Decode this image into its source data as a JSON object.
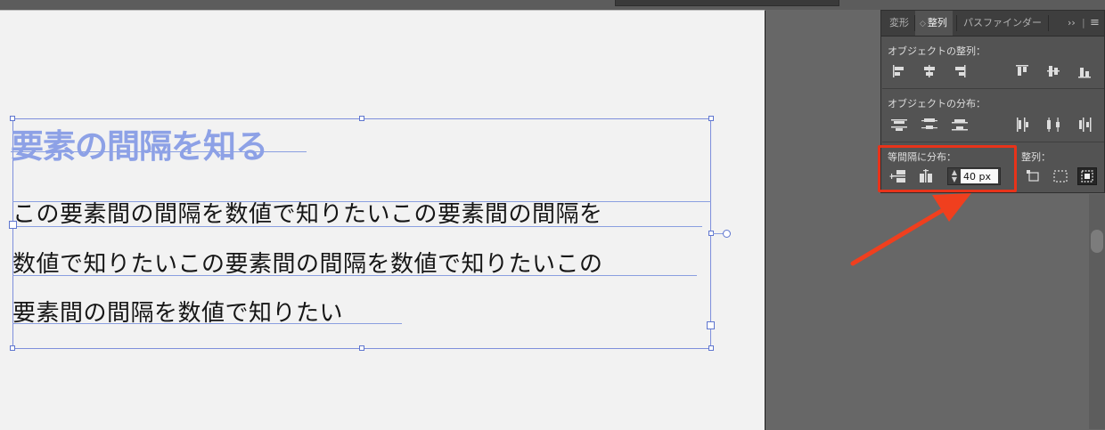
{
  "artboard": {
    "heading": "要素の間隔を知る",
    "body_lines": [
      "この要素間の間隔を数値で知りたいこの要素間の間隔を",
      "数値で知りたいこの要素間の間隔を数値で知りたいこの",
      "要素間の間隔を数値で知りたい"
    ]
  },
  "panel": {
    "tabs": [
      {
        "label": "変形",
        "active": false
      },
      {
        "label": "整列",
        "active": true
      },
      {
        "label": "パスファインダー",
        "active": false
      }
    ],
    "collapse_glyph": "››",
    "menu_glyph": "≡",
    "align_objects_label": "オブジェクトの整列：",
    "distribute_objects_label": "オブジェクトの分布：",
    "distribute_spacing_label": "等間隔に分布：",
    "align_to_label": "整列：",
    "spacing_value": "40 px",
    "stepper_up": "▲",
    "stepper_down": "▼"
  },
  "colors": {
    "annotation": "#e8331a",
    "selection": "#7e8fdc",
    "panel_bg": "#535353"
  }
}
